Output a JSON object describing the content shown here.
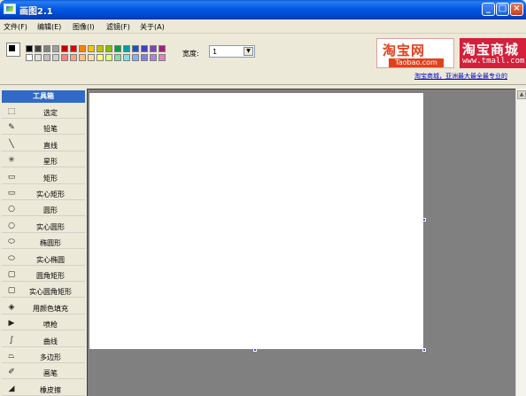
{
  "window": {
    "title": "画图2.1"
  },
  "menu": [
    {
      "label": "文件(F)"
    },
    {
      "label": "编辑(E)"
    },
    {
      "label": "图像(I)"
    },
    {
      "label": "滤镜(F)"
    },
    {
      "label": "关于(A)"
    }
  ],
  "palette": {
    "row1": [
      "#000000",
      "#404040",
      "#808080",
      "#a0a0a0",
      "#c00000",
      "#e00000",
      "#ff8000",
      "#ffc000",
      "#c0c000",
      "#80c000",
      "#00a040",
      "#00a0a0",
      "#2050c0",
      "#4040c0",
      "#8040c0",
      "#a02080"
    ],
    "row2": [
      "#ffffff",
      "#e0e0e0",
      "#c0c0c0",
      "#d0d0d0",
      "#ff8080",
      "#ffa080",
      "#ffc080",
      "#ffe0a0",
      "#ffff80",
      "#e0ff80",
      "#80e0a0",
      "#80e0e0",
      "#80b0ff",
      "#8080e0",
      "#b080e0",
      "#e080c0"
    ]
  },
  "toolbar": {
    "width_label": "宽度:",
    "width_value": "1"
  },
  "ads": {
    "taobao_main": "淘宝网",
    "taobao_sub": "Taobao.com",
    "tmall_main": "淘宝商城",
    "tmall_sub": "www.tmall.com",
    "link_text": "淘宝商城，亚洲最大最全最专业的"
  },
  "toolbox": {
    "title": "工具箱",
    "tools": [
      {
        "label": "选定",
        "icon": "select-rect-icon"
      },
      {
        "label": "铅笔",
        "icon": "pencil-icon"
      },
      {
        "label": "直线",
        "icon": "line-icon"
      },
      {
        "label": "星形",
        "icon": "star-icon"
      },
      {
        "label": "矩形",
        "icon": "rectangle-icon"
      },
      {
        "label": "实心矩形",
        "icon": "filled-rectangle-icon"
      },
      {
        "label": "圆形",
        "icon": "circle-icon"
      },
      {
        "label": "实心圆形",
        "icon": "filled-circle-icon"
      },
      {
        "label": "椭圆形",
        "icon": "ellipse-icon"
      },
      {
        "label": "实心椭圆",
        "icon": "filled-ellipse-icon"
      },
      {
        "label": "圆角矩形",
        "icon": "rounded-rect-icon"
      },
      {
        "label": "实心圆角矩形",
        "icon": "filled-rounded-rect-icon"
      },
      {
        "label": "用颜色填充",
        "icon": "fill-bucket-icon"
      },
      {
        "label": "喷枪",
        "icon": "airbrush-icon"
      },
      {
        "label": "曲线",
        "icon": "curve-icon"
      },
      {
        "label": "多边形",
        "icon": "polygon-icon"
      },
      {
        "label": "画笔",
        "icon": "brush-icon"
      },
      {
        "label": "橡皮擦",
        "icon": "eraser-icon"
      }
    ]
  }
}
